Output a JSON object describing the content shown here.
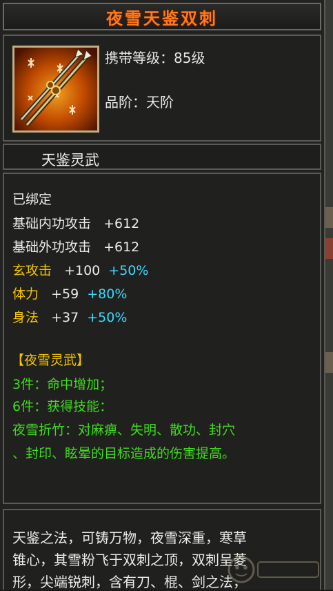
{
  "title": "夜雪天鉴双刺",
  "item": {
    "icon": "twin-blade-weapon-icon",
    "level_label": "携带等级：85级",
    "grade_label": "品阶：天阶"
  },
  "subtitle": "天鉴灵武",
  "stats": {
    "bound": "已绑定",
    "lines": [
      {
        "label": "基础内功攻击",
        "value": "+612",
        "bonus": ""
      },
      {
        "label": "基础外功攻击",
        "value": "+612",
        "bonus": ""
      },
      {
        "label": "玄攻击",
        "value": "+100",
        "bonus": "+50%"
      },
      {
        "label": "体力",
        "value": "+59",
        "bonus": "+80%"
      },
      {
        "label": "身法",
        "value": "+37",
        "bonus": "+50%"
      }
    ],
    "set_name": "【夜雪灵武】",
    "set_3": "3件：命中增加；",
    "set_6": "6件：获得技能：",
    "skill_line1": "夜雪折竹：对麻痹、失明、散功、封穴",
    "skill_line2": "、封印、眩晕的目标造成的伤害提高。"
  },
  "description": [
    "天鉴之法，可铸万物，夜雪深重，寒草",
    "锥心，其雪粉飞于双刺之顶，双刺呈菱",
    "形，尖端锐刺，含有刀、棍、剑之法，"
  ],
  "colors": {
    "title": "#ff7a1a",
    "yellow": "#f4c400",
    "green": "#3fdc1e",
    "cyan": "#3fd8ff"
  }
}
